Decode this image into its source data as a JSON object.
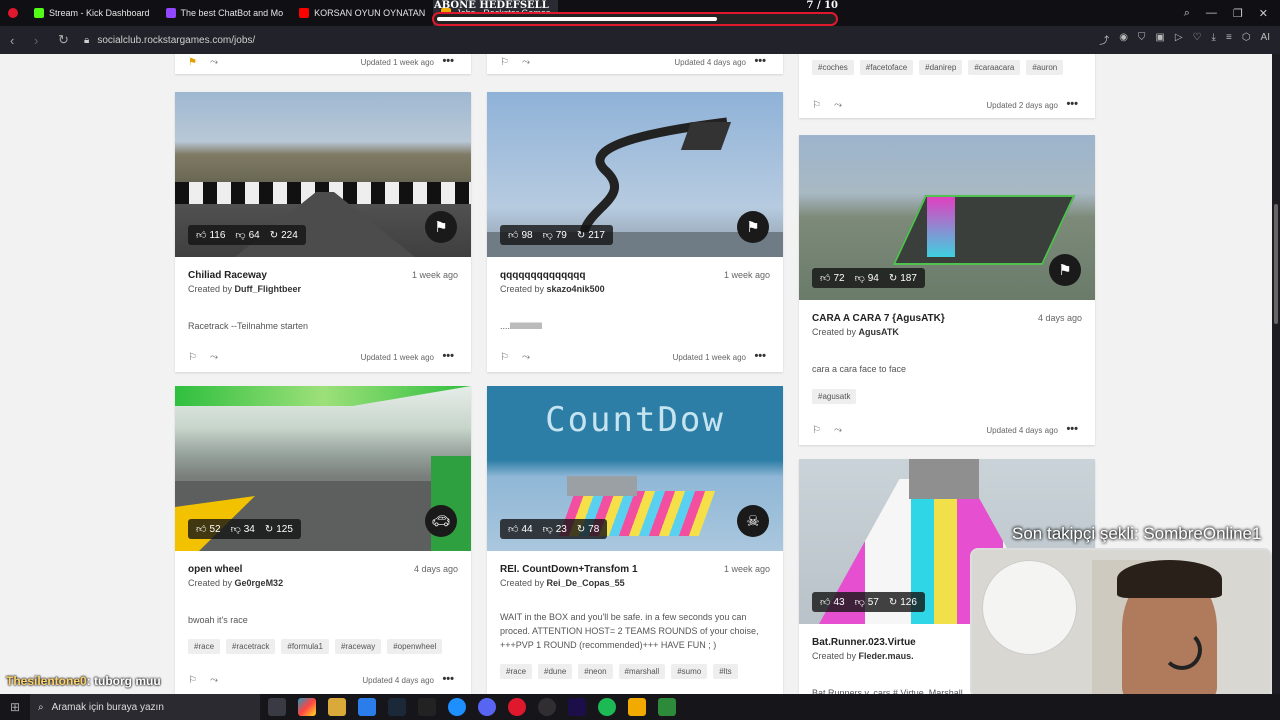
{
  "tabs": [
    {
      "label": "Stream - Kick Dashboard",
      "color": "#53fc18"
    },
    {
      "label": "The best ChatBot and Mo",
      "color": "#9146ff"
    },
    {
      "label": "KORSAN OYUN OYNATAN",
      "color": "#ff0000"
    },
    {
      "label": "Jobs - Rockstar Games",
      "color": "#f2a900"
    }
  ],
  "overlay": {
    "title": "ABONE HEDEFSELL",
    "count": "7 / 10",
    "progress": 0.7
  },
  "address": {
    "url": "socialclub.rockstargames.com/jobs/"
  },
  "top_row": [
    {
      "updated": "Updated 1 week ago"
    },
    {
      "updated": "Updated 4 days ago"
    },
    {
      "tags": [
        "#coches",
        "#facetoface",
        "#danirep",
        "#caraacara",
        "#auron"
      ],
      "updated": "Updated 2 days ago"
    }
  ],
  "cards": [
    {
      "likes": "116",
      "dislikes": "64",
      "plays": "224",
      "title": "Chiliad Raceway",
      "when": "1 week ago",
      "by_prefix": "Created by",
      "creator": "Duff_Flightbeer",
      "desc": "Racetrack --Teilnahme starten",
      "tags": [],
      "updated": "Updated 1 week ago",
      "badge_icon": "checkered-flag-icon"
    },
    {
      "likes": "98",
      "dislikes": "79",
      "plays": "217",
      "title": "qqqqqqqqqqqqqq",
      "when": "1 week ago",
      "by_prefix": "Created by",
      "creator": "skazo4nik500",
      "desc": "....llllllllllllllll",
      "tags": [],
      "updated": "Updated 1 week ago",
      "badge_icon": "checkered-flag-icon"
    },
    {
      "likes": "72",
      "dislikes": "94",
      "plays": "187",
      "title": "CARA A CARA 7 {AgusATK}",
      "when": "4 days ago",
      "by_prefix": "Created by",
      "creator": "AgusATK",
      "desc": "cara a cara face to face",
      "tags": [
        "#agusatk"
      ],
      "updated": "Updated 4 days ago",
      "badge_icon": "checkered-flag-icon"
    },
    {
      "likes": "52",
      "dislikes": "34",
      "plays": "125",
      "title": "open wheel",
      "when": "4 days ago",
      "by_prefix": "Created by",
      "creator": "Ge0rgeM32",
      "desc": "bwoah it's race",
      "tags": [
        "#race",
        "#racetrack",
        "#formula1",
        "#raceway",
        "#openwheel"
      ],
      "updated": "Updated 4 days ago",
      "badge_icon": "car-icon"
    },
    {
      "likes": "44",
      "dislikes": "23",
      "plays": "78",
      "title": "REI. CountDown+Transfom 1",
      "when": "1 week ago",
      "by_prefix": "Created by",
      "creator": "Rei_De_Copas_55",
      "desc": "WAIT in the BOX and you'll be safe. in a few seconds you can proced. ATTENTION HOST= 2 TEAMS ROUNDS of your choise, +++PVP 1 ROUND (recommended)+++ HAVE FUN ; )",
      "tags": [
        "#race",
        "#dune",
        "#neon",
        "#marshall",
        "#sumo",
        "#lts"
      ],
      "updated": "",
      "badge_icon": "skull-icon",
      "thumb_text": "CountDow"
    },
    {
      "likes": "43",
      "dislikes": "57",
      "plays": "126",
      "title": "Bat.Runner.023.Virtue",
      "when": "",
      "by_prefix": "Created by",
      "creator": "Fleder.maus.",
      "desc": "Bat Runners v. cars # Virtue. Marshall",
      "tags": [],
      "updated": "",
      "badge_icon": ""
    }
  ],
  "stream": {
    "follower_text": "Son takipçi şekli: SombreOnline1",
    "chat_user": "Thesilentone0",
    "chat_msg": ": tuborg muu"
  },
  "taskbar": {
    "search_placeholder": "Aramak için buraya yazın"
  }
}
